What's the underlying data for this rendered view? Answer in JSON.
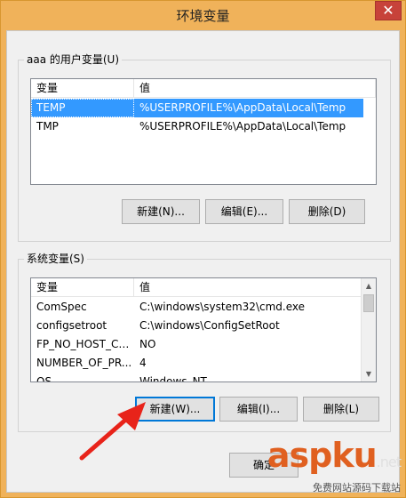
{
  "window": {
    "title": "环境变量",
    "close_glyph": "✕"
  },
  "user_vars": {
    "group_label": "aaa 的用户变量(U)",
    "columns": [
      "变量",
      "值"
    ],
    "rows": [
      {
        "name": "TEMP",
        "value": "%USERPROFILE%\\AppData\\Local\\Temp",
        "selected": true
      },
      {
        "name": "TMP",
        "value": "%USERPROFILE%\\AppData\\Local\\Temp",
        "selected": false
      }
    ],
    "buttons": {
      "new": "新建(N)...",
      "edit": "编辑(E)...",
      "delete": "删除(D)"
    }
  },
  "system_vars": {
    "group_label": "系统变量(S)",
    "columns": [
      "变量",
      "值"
    ],
    "rows": [
      {
        "name": "ComSpec",
        "value": "C:\\windows\\system32\\cmd.exe"
      },
      {
        "name": "configsetroot",
        "value": "C:\\windows\\ConfigSetRoot"
      },
      {
        "name": "FP_NO_HOST_CH...",
        "value": "NO"
      },
      {
        "name": "NUMBER_OF_PR...",
        "value": "4"
      },
      {
        "name": "OS",
        "value": "Windows_NT"
      }
    ],
    "buttons": {
      "new": "新建(W)...",
      "edit": "编辑(I)...",
      "delete": "删除(L)"
    }
  },
  "footer": {
    "ok": "确定"
  },
  "watermark": {
    "brand": "aspku",
    "suffix": ".net",
    "sub": "免费网站源码下载站"
  },
  "colors": {
    "selection": "#3399ff",
    "arrow": "#e8231a",
    "accent_focus": "#0078d7"
  }
}
